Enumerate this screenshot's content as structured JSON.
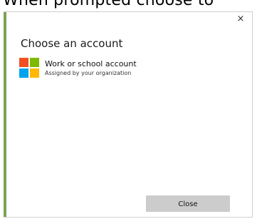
{
  "instruction": {
    "text": "When prompted choose to"
  },
  "dialog": {
    "close_glyph": "×",
    "title": "Choose an account",
    "account": {
      "icon": "microsoft-logo",
      "name": "Work or school account",
      "subtitle": "Assigned by your organization"
    },
    "close_button_label": "Close"
  },
  "colors": {
    "accent_bar": "#7aa44f",
    "logo_red": "#f25022",
    "logo_green": "#7fba00",
    "logo_blue": "#00a4ef",
    "logo_yellow": "#ffb900",
    "button_bg": "#cccccc"
  }
}
